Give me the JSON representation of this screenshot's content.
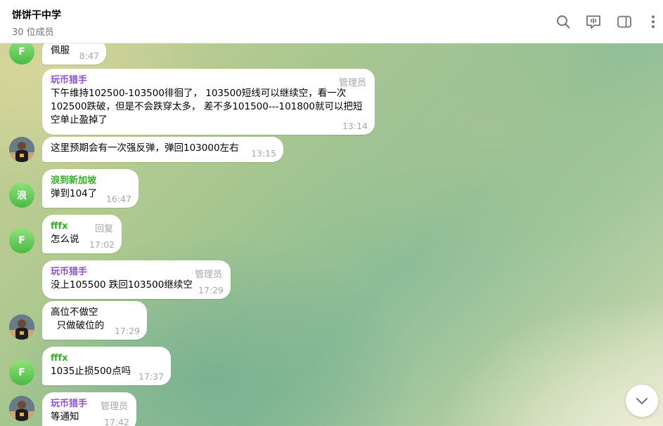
{
  "header": {
    "title": "饼饼干中学",
    "subtitle": "30 位成员"
  },
  "colors": {
    "purple_sender": "#8e4fcf",
    "green_sender": "#3aaa2c",
    "meta_gray": "#a3a8ad"
  },
  "icons": [
    "search-icon",
    "live-chat-icon",
    "sidebar-toggle-icon",
    "more-vertical-icon",
    "chevron-down-icon"
  ],
  "messages": [
    {
      "avatar": "F",
      "text": "佩服",
      "time": "8:47"
    },
    {
      "sender": "玩币猎手",
      "tag": "管理员",
      "text": "下午维持102500-103500徘徊了， 103500短线可以继续空，看一次\n102500跌破，但是不会跌穿太多， 差不多101500---101800就可以把短\n空单止盈掉了",
      "time": "13:14"
    },
    {
      "text": "这里预期会有一次强反弹，弹回103000左右",
      "time": "13:15"
    },
    {
      "avatar": "浪",
      "sender": "浪到新加坡",
      "text": "弹到104了",
      "time": "16:47"
    },
    {
      "avatar": "F",
      "sender": "fffx",
      "tag": "回复",
      "text": "怎么说",
      "time": "17:02"
    },
    {
      "sender": "玩币猎手",
      "tag": "管理员",
      "text": "没上105500 跌回103500继续空",
      "time": "17:29"
    },
    {
      "text": "高位不做空\n  只做破位的",
      "time": "17:29"
    },
    {
      "avatar": "F",
      "sender": "fffx",
      "text": "1035止损500点吗",
      "time": "17:37"
    },
    {
      "sender": "玩币猎手",
      "tag": "管理员",
      "text": "等通知",
      "time": "17:42"
    }
  ]
}
